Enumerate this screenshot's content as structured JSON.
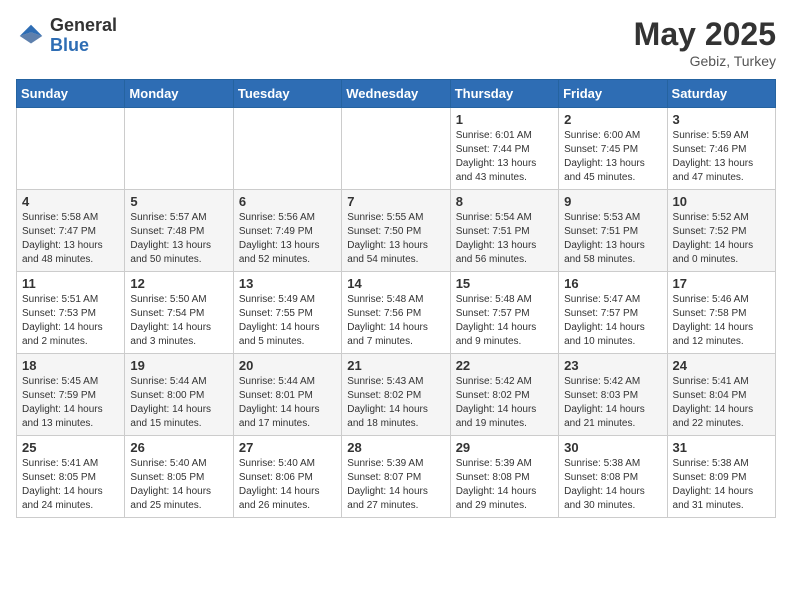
{
  "header": {
    "logo_general": "General",
    "logo_blue": "Blue",
    "month_title": "May 2025",
    "location": "Gebiz, Turkey"
  },
  "weekdays": [
    "Sunday",
    "Monday",
    "Tuesday",
    "Wednesday",
    "Thursday",
    "Friday",
    "Saturday"
  ],
  "weeks": [
    [
      {
        "day": "",
        "info": ""
      },
      {
        "day": "",
        "info": ""
      },
      {
        "day": "",
        "info": ""
      },
      {
        "day": "",
        "info": ""
      },
      {
        "day": "1",
        "info": "Sunrise: 6:01 AM\nSunset: 7:44 PM\nDaylight: 13 hours\nand 43 minutes."
      },
      {
        "day": "2",
        "info": "Sunrise: 6:00 AM\nSunset: 7:45 PM\nDaylight: 13 hours\nand 45 minutes."
      },
      {
        "day": "3",
        "info": "Sunrise: 5:59 AM\nSunset: 7:46 PM\nDaylight: 13 hours\nand 47 minutes."
      }
    ],
    [
      {
        "day": "4",
        "info": "Sunrise: 5:58 AM\nSunset: 7:47 PM\nDaylight: 13 hours\nand 48 minutes."
      },
      {
        "day": "5",
        "info": "Sunrise: 5:57 AM\nSunset: 7:48 PM\nDaylight: 13 hours\nand 50 minutes."
      },
      {
        "day": "6",
        "info": "Sunrise: 5:56 AM\nSunset: 7:49 PM\nDaylight: 13 hours\nand 52 minutes."
      },
      {
        "day": "7",
        "info": "Sunrise: 5:55 AM\nSunset: 7:50 PM\nDaylight: 13 hours\nand 54 minutes."
      },
      {
        "day": "8",
        "info": "Sunrise: 5:54 AM\nSunset: 7:51 PM\nDaylight: 13 hours\nand 56 minutes."
      },
      {
        "day": "9",
        "info": "Sunrise: 5:53 AM\nSunset: 7:51 PM\nDaylight: 13 hours\nand 58 minutes."
      },
      {
        "day": "10",
        "info": "Sunrise: 5:52 AM\nSunset: 7:52 PM\nDaylight: 14 hours\nand 0 minutes."
      }
    ],
    [
      {
        "day": "11",
        "info": "Sunrise: 5:51 AM\nSunset: 7:53 PM\nDaylight: 14 hours\nand 2 minutes."
      },
      {
        "day": "12",
        "info": "Sunrise: 5:50 AM\nSunset: 7:54 PM\nDaylight: 14 hours\nand 3 minutes."
      },
      {
        "day": "13",
        "info": "Sunrise: 5:49 AM\nSunset: 7:55 PM\nDaylight: 14 hours\nand 5 minutes."
      },
      {
        "day": "14",
        "info": "Sunrise: 5:48 AM\nSunset: 7:56 PM\nDaylight: 14 hours\nand 7 minutes."
      },
      {
        "day": "15",
        "info": "Sunrise: 5:48 AM\nSunset: 7:57 PM\nDaylight: 14 hours\nand 9 minutes."
      },
      {
        "day": "16",
        "info": "Sunrise: 5:47 AM\nSunset: 7:57 PM\nDaylight: 14 hours\nand 10 minutes."
      },
      {
        "day": "17",
        "info": "Sunrise: 5:46 AM\nSunset: 7:58 PM\nDaylight: 14 hours\nand 12 minutes."
      }
    ],
    [
      {
        "day": "18",
        "info": "Sunrise: 5:45 AM\nSunset: 7:59 PM\nDaylight: 14 hours\nand 13 minutes."
      },
      {
        "day": "19",
        "info": "Sunrise: 5:44 AM\nSunset: 8:00 PM\nDaylight: 14 hours\nand 15 minutes."
      },
      {
        "day": "20",
        "info": "Sunrise: 5:44 AM\nSunset: 8:01 PM\nDaylight: 14 hours\nand 17 minutes."
      },
      {
        "day": "21",
        "info": "Sunrise: 5:43 AM\nSunset: 8:02 PM\nDaylight: 14 hours\nand 18 minutes."
      },
      {
        "day": "22",
        "info": "Sunrise: 5:42 AM\nSunset: 8:02 PM\nDaylight: 14 hours\nand 19 minutes."
      },
      {
        "day": "23",
        "info": "Sunrise: 5:42 AM\nSunset: 8:03 PM\nDaylight: 14 hours\nand 21 minutes."
      },
      {
        "day": "24",
        "info": "Sunrise: 5:41 AM\nSunset: 8:04 PM\nDaylight: 14 hours\nand 22 minutes."
      }
    ],
    [
      {
        "day": "25",
        "info": "Sunrise: 5:41 AM\nSunset: 8:05 PM\nDaylight: 14 hours\nand 24 minutes."
      },
      {
        "day": "26",
        "info": "Sunrise: 5:40 AM\nSunset: 8:05 PM\nDaylight: 14 hours\nand 25 minutes."
      },
      {
        "day": "27",
        "info": "Sunrise: 5:40 AM\nSunset: 8:06 PM\nDaylight: 14 hours\nand 26 minutes."
      },
      {
        "day": "28",
        "info": "Sunrise: 5:39 AM\nSunset: 8:07 PM\nDaylight: 14 hours\nand 27 minutes."
      },
      {
        "day": "29",
        "info": "Sunrise: 5:39 AM\nSunset: 8:08 PM\nDaylight: 14 hours\nand 29 minutes."
      },
      {
        "day": "30",
        "info": "Sunrise: 5:38 AM\nSunset: 8:08 PM\nDaylight: 14 hours\nand 30 minutes."
      },
      {
        "day": "31",
        "info": "Sunrise: 5:38 AM\nSunset: 8:09 PM\nDaylight: 14 hours\nand 31 minutes."
      }
    ]
  ]
}
